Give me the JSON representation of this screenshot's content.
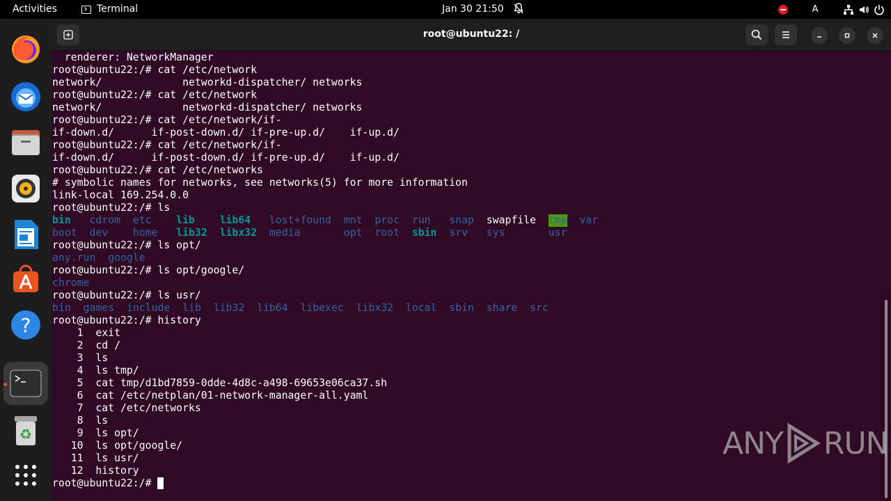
{
  "topbar": {
    "activities": "Activities",
    "app_name": "Terminal",
    "clock": "Jan 30  21:50",
    "input_indicator": "A"
  },
  "window": {
    "title": "root@ubuntu22: /"
  },
  "terminal": {
    "lines": [
      {
        "text": "  renderer: NetworkManager"
      },
      {
        "text": "root@ubuntu22:/# cat /etc/network"
      },
      {
        "text": "network/             networkd-dispatcher/ networks"
      },
      {
        "text": "root@ubuntu22:/# cat /etc/network"
      },
      {
        "text": "network/             networkd-dispatcher/ networks"
      },
      {
        "text": "root@ubuntu22:/# cat /etc/network/if-"
      },
      {
        "text": "if-down.d/      if-post-down.d/ if-pre-up.d/    if-up.d/"
      },
      {
        "text": "root@ubuntu22:/# cat /etc/network/if-"
      },
      {
        "text": "if-down.d/      if-post-down.d/ if-pre-up.d/    if-up.d/"
      },
      {
        "text": "root@ubuntu22:/# cat /etc/networks"
      },
      {
        "text": "# symbolic names for networks, see networks(5) for more information"
      },
      {
        "text": "link-local 169.254.0.0"
      },
      {
        "text": "root@ubuntu22:/# ls"
      },
      {
        "tokens": [
          {
            "t": "bin",
            "c": "lnk"
          },
          {
            "t": "   "
          },
          {
            "t": "cdrom",
            "c": "dir"
          },
          {
            "t": "  "
          },
          {
            "t": "etc",
            "c": "dir"
          },
          {
            "t": "    "
          },
          {
            "t": "lib",
            "c": "lnk"
          },
          {
            "t": "    "
          },
          {
            "t": "lib64",
            "c": "lnk"
          },
          {
            "t": "   "
          },
          {
            "t": "lost+found",
            "c": "dir"
          },
          {
            "t": "  "
          },
          {
            "t": "mnt",
            "c": "dir"
          },
          {
            "t": "  "
          },
          {
            "t": "proc",
            "c": "dir"
          },
          {
            "t": "  "
          },
          {
            "t": "run",
            "c": "dir"
          },
          {
            "t": "   "
          },
          {
            "t": "snap",
            "c": "dir"
          },
          {
            "t": "  "
          },
          {
            "t": "swapfile"
          },
          {
            "t": "  "
          },
          {
            "t": "tmp",
            "c": "tmpd"
          },
          {
            "t": "  "
          },
          {
            "t": "var",
            "c": "dir"
          }
        ]
      },
      {
        "tokens": [
          {
            "t": "boot",
            "c": "dir"
          },
          {
            "t": "  "
          },
          {
            "t": "dev",
            "c": "dir"
          },
          {
            "t": "    "
          },
          {
            "t": "home",
            "c": "dir"
          },
          {
            "t": "   "
          },
          {
            "t": "lib32",
            "c": "lnk"
          },
          {
            "t": "  "
          },
          {
            "t": "libx32",
            "c": "lnk"
          },
          {
            "t": "  "
          },
          {
            "t": "media",
            "c": "dir"
          },
          {
            "t": "       "
          },
          {
            "t": "opt",
            "c": "dir"
          },
          {
            "t": "  "
          },
          {
            "t": "root",
            "c": "dir"
          },
          {
            "t": "  "
          },
          {
            "t": "sbin",
            "c": "lnk"
          },
          {
            "t": "  "
          },
          {
            "t": "srv",
            "c": "dir"
          },
          {
            "t": "   "
          },
          {
            "t": "sys",
            "c": "dir"
          },
          {
            "t": "       "
          },
          {
            "t": "usr",
            "c": "dir"
          }
        ]
      },
      {
        "text": "root@ubuntu22:/# ls opt/"
      },
      {
        "tokens": [
          {
            "t": "any.run",
            "c": "dir"
          },
          {
            "t": "  "
          },
          {
            "t": "google",
            "c": "dir"
          }
        ]
      },
      {
        "text": "root@ubuntu22:/# ls opt/google/"
      },
      {
        "tokens": [
          {
            "t": "chrome",
            "c": "dir"
          }
        ]
      },
      {
        "text": "root@ubuntu22:/# ls usr/"
      },
      {
        "tokens": [
          {
            "t": "bin",
            "c": "dir"
          },
          {
            "t": "  "
          },
          {
            "t": "games",
            "c": "dir"
          },
          {
            "t": "  "
          },
          {
            "t": "include",
            "c": "dir"
          },
          {
            "t": "  "
          },
          {
            "t": "lib",
            "c": "dir"
          },
          {
            "t": "  "
          },
          {
            "t": "lib32",
            "c": "dir"
          },
          {
            "t": "  "
          },
          {
            "t": "lib64",
            "c": "dir"
          },
          {
            "t": "  "
          },
          {
            "t": "libexec",
            "c": "dir"
          },
          {
            "t": "  "
          },
          {
            "t": "libx32",
            "c": "dir"
          },
          {
            "t": "  "
          },
          {
            "t": "local",
            "c": "dir"
          },
          {
            "t": "  "
          },
          {
            "t": "sbin",
            "c": "dir"
          },
          {
            "t": "  "
          },
          {
            "t": "share",
            "c": "dir"
          },
          {
            "t": "  "
          },
          {
            "t": "src",
            "c": "dir"
          }
        ]
      },
      {
        "text": "root@ubuntu22:/# history"
      },
      {
        "text": "    1  exit"
      },
      {
        "text": "    2  cd /"
      },
      {
        "text": "    3  ls"
      },
      {
        "text": "    4  ls tmp/"
      },
      {
        "text": "    5  cat tmp/d1bd7859-0dde-4d8c-a498-69653e06ca37.sh"
      },
      {
        "text": "    6  cat /etc/netplan/01-network-manager-all.yaml"
      },
      {
        "text": "    7  cat /etc/networks"
      },
      {
        "text": "    8  ls"
      },
      {
        "text": "    9  ls opt/"
      },
      {
        "text": "   10  ls opt/google/"
      },
      {
        "text": "   11  ls usr/"
      },
      {
        "text": "   12  history"
      },
      {
        "text": "root@ubuntu22:/# ",
        "cursor": true
      }
    ]
  },
  "watermark": {
    "left": "ANY",
    "right": "RUN"
  },
  "colors": {
    "terminal_bg": "#300a24",
    "dir": "#3465a4",
    "link": "#06989a",
    "accent": "#e95420"
  }
}
